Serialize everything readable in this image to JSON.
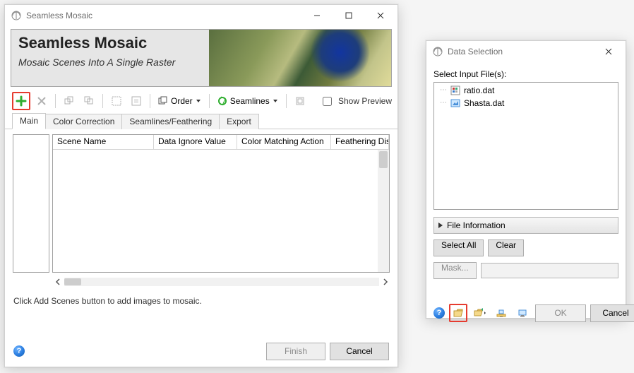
{
  "mosaic": {
    "window_title": "Seamless Mosaic",
    "banner_title": "Seamless Mosaic",
    "banner_subtitle": "Mosaic Scenes Into A Single Raster",
    "toolbar": {
      "order_label": "Order",
      "seamlines_label": "Seamlines",
      "show_preview_label": "Show Preview",
      "show_preview_checked": false
    },
    "tabs": [
      {
        "label": "Main",
        "active": true
      },
      {
        "label": "Color Correction",
        "active": false
      },
      {
        "label": "Seamlines/Feathering",
        "active": false
      },
      {
        "label": "Export",
        "active": false
      }
    ],
    "columns": [
      "Scene Name",
      "Data Ignore Value",
      "Color Matching Action",
      "Feathering Distance"
    ],
    "hint": "Click Add Scenes button to add images to mosaic.",
    "footer": {
      "finish": "Finish",
      "cancel": "Cancel"
    }
  },
  "data_selection": {
    "window_title": "Data Selection",
    "select_label": "Select Input File(s):",
    "files": [
      "ratio.dat",
      "Shasta.dat"
    ],
    "file_info_label": "File Information",
    "select_all": "Select All",
    "clear": "Clear",
    "mask": "Mask...",
    "ok": "OK",
    "cancel": "Cancel"
  }
}
